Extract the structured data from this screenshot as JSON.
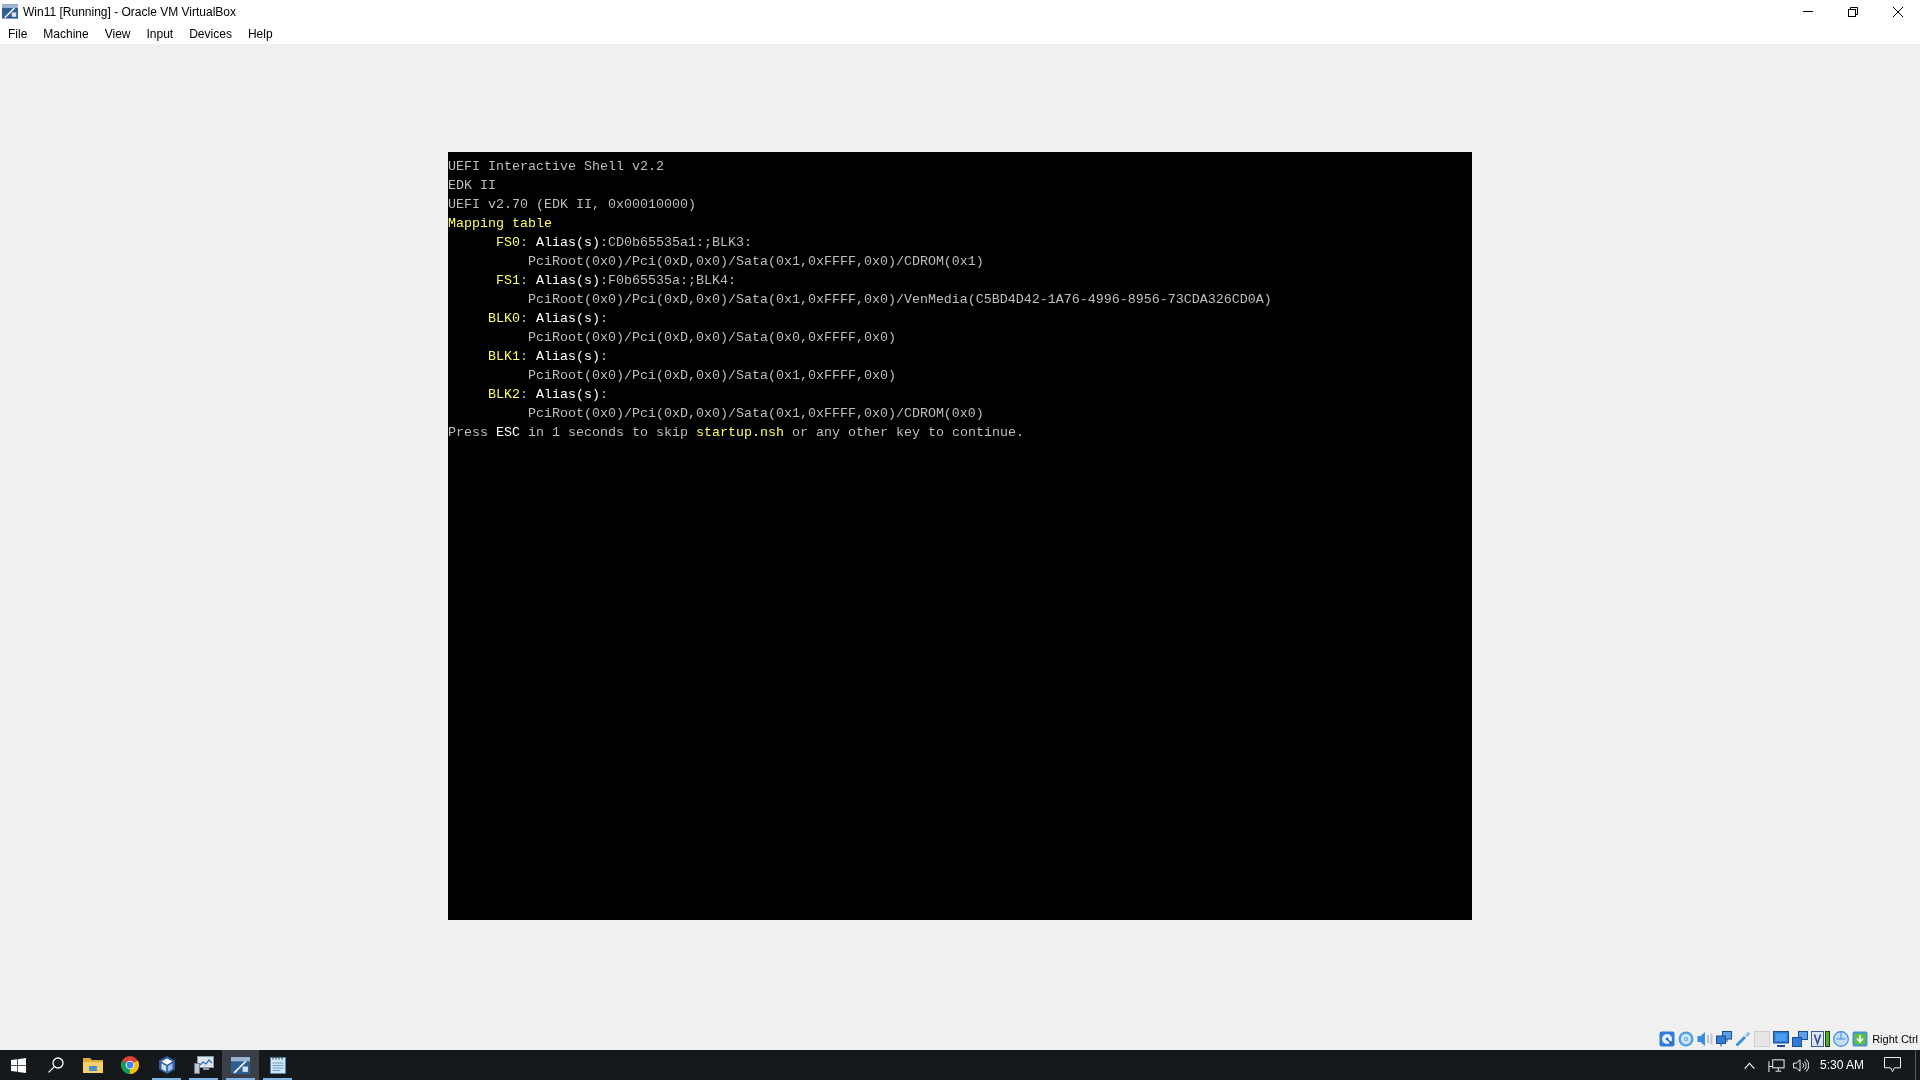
{
  "window": {
    "title": "Win11 [Running] - Oracle VM VirtualBox"
  },
  "menu_bar": [
    "File",
    "Machine",
    "View",
    "Input",
    "Devices",
    "Help"
  ],
  "console": {
    "header": [
      "UEFI Interactive Shell v2.2",
      "EDK II",
      "UEFI v2.70 (EDK II, 0x00010000)"
    ],
    "mapping_table": {
      "title": "Mapping table",
      "entries": [
        {
          "name": "FS0",
          "separator": ":",
          "label": "Alias(s)",
          "aliases": ":CD0b65535a1:;BLK3:",
          "path": "PciRoot(0x0)/Pci(0xD,0x0)/Sata(0x1,0xFFFF,0x0)/CDROM(0x1)"
        },
        {
          "name": "FS1",
          "separator": ":",
          "label": "Alias(s)",
          "aliases": ":F0b65535a:;BLK4:",
          "path": "PciRoot(0x0)/Pci(0xD,0x0)/Sata(0x1,0xFFFF,0x0)/VenMedia(C5BD4D42-1A76-4996-8956-73CDA326CD0A)"
        },
        {
          "name": "BLK0",
          "separator": ":",
          "label": "Alias(s)",
          "aliases": ":",
          "path": "PciRoot(0x0)/Pci(0xD,0x0)/Sata(0x0,0xFFFF,0x0)"
        },
        {
          "name": "BLK1",
          "separator": ":",
          "label": "Alias(s)",
          "aliases": ":",
          "path": "PciRoot(0x0)/Pci(0xD,0x0)/Sata(0x1,0xFFFF,0x0)"
        },
        {
          "name": "BLK2",
          "separator": ":",
          "label": "Alias(s)",
          "aliases": ":",
          "path": "PciRoot(0x0)/Pci(0xD,0x0)/Sata(0x1,0xFFFF,0x0)/CDROM(0x0)"
        }
      ]
    },
    "prompt": [
      {
        "text": "Press ",
        "kind": "normal"
      },
      {
        "text": "ESC",
        "kind": "bright"
      },
      {
        "text": " in 1 seconds to skip ",
        "kind": "normal"
      },
      {
        "text": "startup.nsh",
        "kind": "highlight"
      },
      {
        "text": " or any other key to continue.",
        "kind": "normal"
      }
    ]
  },
  "status_bar": {
    "host_key": "Right Ctrl"
  },
  "taskbar": {
    "apps": [
      {
        "kind": "folder",
        "running": false,
        "selected": false
      },
      {
        "kind": "circle-logo",
        "running": false,
        "selected": false
      },
      {
        "kind": "cube",
        "running": true,
        "selected": false
      },
      {
        "kind": "chart-monitor",
        "running": true,
        "selected": false
      },
      {
        "kind": "vm-window",
        "running": true,
        "selected": true
      },
      {
        "kind": "notepad",
        "running": true,
        "selected": false
      }
    ],
    "clock": "5:30 AM"
  }
}
